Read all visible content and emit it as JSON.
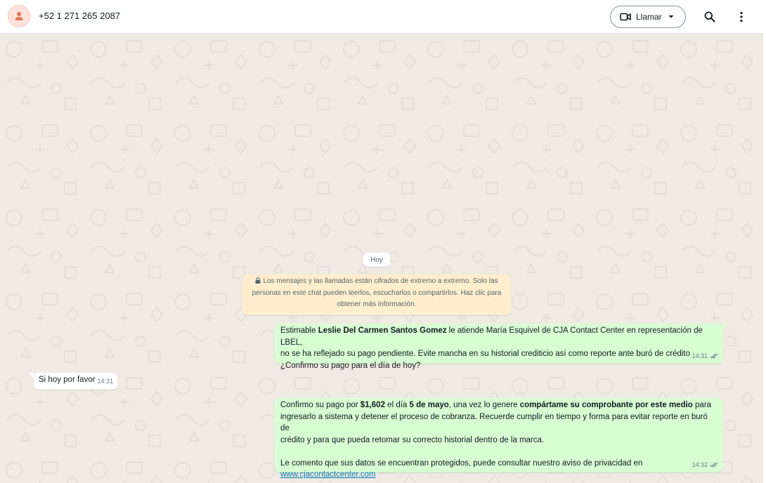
{
  "header": {
    "contact_name": "+52 1 271 265 2087",
    "call_label": "Llamar",
    "icons": {
      "avatar": "person-icon",
      "call": "video-camera-icon",
      "dropdown": "caret-down-icon",
      "search": "search-icon",
      "menu": "more-vertical-icon"
    }
  },
  "chat": {
    "date_chip": "Hoy",
    "encryption_notice": {
      "line1": "Los mensajes y las llamadas están cifrados de extremo a extremo. Solo las",
      "line2": "personas en este chat pueden leerlos, escucharlos o compartirlos. Haz clic para",
      "line3": "obtener más información."
    },
    "messages": [
      {
        "direction": "outgoing",
        "p1_a": "Estimable ",
        "p1_b": "Leslie Del Carmen Santos Gomez",
        "p1_c": " le atiende María Esquivel de CJA Contact Center en representación de LBEL,",
        "p2": "no se ha reflejado su pago pendiente. Evite mancha en su historial crediticio así como reporte ante buró de crédito",
        "p3": "¿Confirmo su pago para el día de hoy?",
        "time": "14:31",
        "status": "read"
      },
      {
        "direction": "incoming",
        "text": "Si hoy por favor",
        "time": "14:31"
      },
      {
        "direction": "outgoing",
        "a": "Confirmo su pago por ",
        "b": "$1,602",
        "c": " el día ",
        "d": "5 de mayo",
        "e": ", una vez lo genere ",
        "f": "compártame su comprobante por este medio",
        "g": " para",
        "line2": "ingresarlo a sistema y detener el proceso de cobranza. Recuerde cumplir en tiempo y forma para evitar reporte en buró de",
        "line3": "crédito y para que pueda retomar su correcto historial dentro de la marca.",
        "line4": "Le comento que sus datos se encuentran protegidos, puede consultar nuestro aviso de privacidad en",
        "link": "www.cjacontactcenter.com",
        "time": "14:32",
        "status": "read"
      }
    ]
  },
  "colors": {
    "chat_background": "#efeae2",
    "outgoing_bubble": "#d9fdd3",
    "incoming_bubble": "#ffffff",
    "encryption_banner": "#ffeecd",
    "link": "#027eb5",
    "avatar_background": "#fde3db",
    "avatar_icon": "#e0785a"
  }
}
